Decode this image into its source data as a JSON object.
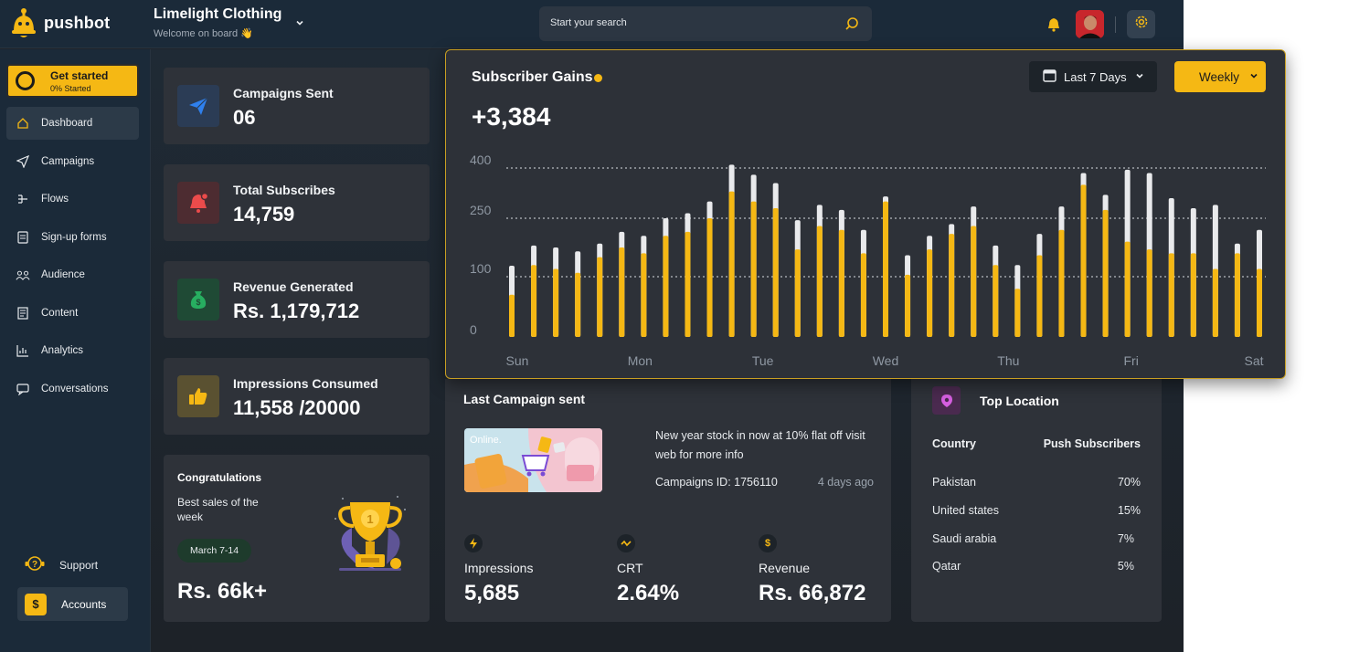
{
  "brand": {
    "name": "pushbot"
  },
  "store": {
    "name": "Limelight Clothing",
    "subtitle": "Welcome on board",
    "emoji": "👋"
  },
  "search": {
    "placeholder": "Start your search"
  },
  "get_started": {
    "title": "Get started",
    "progress_text": "0% Started"
  },
  "nav": {
    "items": [
      {
        "label": "Dashboard",
        "icon": "home-icon",
        "active": true
      },
      {
        "label": "Campaigns",
        "icon": "paper-plane-icon"
      },
      {
        "label": "Flows",
        "icon": "flows-icon"
      },
      {
        "label": "Sign-up forms",
        "icon": "form-icon"
      },
      {
        "label": "Audience",
        "icon": "users-icon"
      },
      {
        "label": "Content",
        "icon": "content-icon"
      },
      {
        "label": "Analytics",
        "icon": "analytics-icon"
      },
      {
        "label": "Conversations",
        "icon": "chat-icon"
      }
    ],
    "support_label": "Support",
    "accounts_label": "Accounts"
  },
  "stats": [
    {
      "label": "Campaigns Sent",
      "value": "06",
      "icon": "paper-plane-icon",
      "color": "#2f80ed"
    },
    {
      "label": "Total Subscribes",
      "value": "14,759",
      "icon": "bell-icon",
      "color": "#eb4b4b"
    },
    {
      "label": "Revenue Generated",
      "value": "Rs. 1,179,712",
      "icon": "money-bag-icon",
      "color": "#27ae60"
    },
    {
      "label": "Impressions Consumed",
      "value": "11,558 /20000",
      "icon": "thumbs-up-icon",
      "color": "#f5b814"
    }
  ],
  "congrats": {
    "title": "Congratulations",
    "subtitle": "Best sales of the week",
    "date_range": "March 7-14",
    "amount": "Rs. 66k+",
    "trophy_rank": "1"
  },
  "chart_card": {
    "title": "Subscriber Gains",
    "total": "+3,384",
    "range_label": "Last 7 Days",
    "period_label": "Weekly"
  },
  "chart_data": {
    "type": "bar",
    "title": "Subscriber Gains",
    "y_ticks": [
      "400",
      "250",
      "100",
      "0"
    ],
    "x_labels": [
      "Sun",
      "Mon",
      "Tue",
      "Wed",
      "Thu",
      "Fri",
      "Sat"
    ],
    "colors": {
      "primary": "#f5b814",
      "total": "#e9eaec"
    },
    "series": [
      {
        "values": [
          70,
          130,
          120,
          110,
          150,
          175,
          160,
          205,
          215,
          250,
          330,
          300,
          280,
          170,
          230,
          220,
          160,
          300,
          105,
          170,
          210,
          230,
          130,
          80,
          155,
          220,
          350,
          275,
          190,
          170,
          160,
          160,
          120,
          160,
          120
        ]
      },
      {
        "values": [
          128,
          180,
          175,
          165,
          185,
          215,
          205,
          250,
          265,
          300,
          410,
          380,
          355,
          245,
          290,
          275,
          220,
          315,
          155,
          205,
          235,
          285,
          180,
          130,
          210,
          285,
          385,
          320,
          395,
          385,
          310,
          280,
          290,
          185,
          220
        ]
      }
    ]
  },
  "last_campaign": {
    "title": "Last Campaign sent",
    "image_text": "Online.",
    "message": "New year stock in now at 10% flat off visit web for more info",
    "campaign_id": "Campaigns ID: 1756110",
    "ago": "4 days ago",
    "metrics": [
      {
        "label": "Impressions",
        "value": "5,685",
        "icon": "lightning-icon"
      },
      {
        "label": "CRT",
        "value": "2.64%",
        "icon": "trend-icon"
      },
      {
        "label": "Revenue",
        "value": "Rs. 66,872",
        "icon": "dollar-icon"
      }
    ]
  },
  "top_location": {
    "title": "Top Location",
    "col_country": "Country",
    "col_subs": "Push Subscribers",
    "rows": [
      {
        "country": "Pakistan",
        "pct": "70%"
      },
      {
        "country": "United states",
        "pct": "15%"
      },
      {
        "country": "Saudi arabia",
        "pct": "7%"
      },
      {
        "country": "Qatar",
        "pct": "5%"
      }
    ]
  },
  "colors": {
    "accent": "#f5b814",
    "sidebar": "#1b2a39",
    "card": "#2e3239"
  }
}
